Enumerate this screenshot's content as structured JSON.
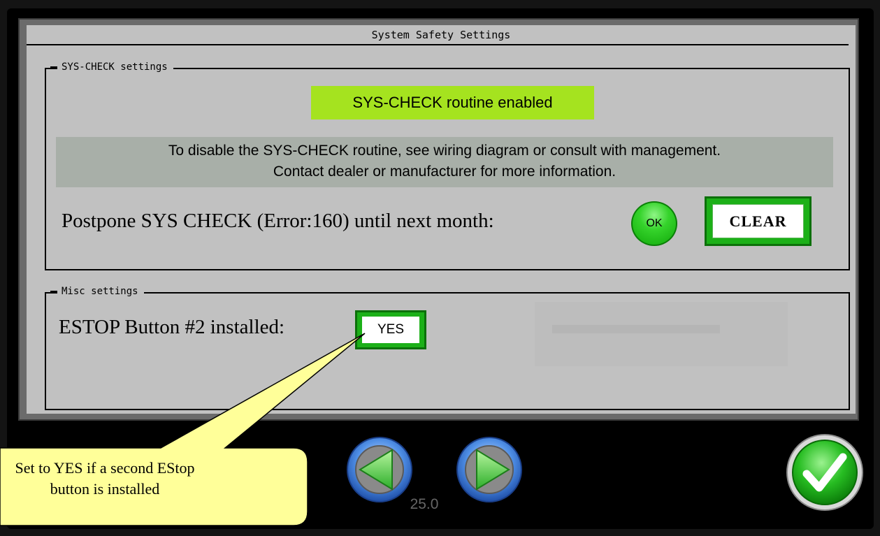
{
  "window": {
    "title": "System Safety Settings"
  },
  "syscheck_group": {
    "legend": "SYS-CHECK settings",
    "status": "SYS-CHECK routine enabled",
    "info_line1": "To disable the SYS-CHECK routine, see wiring diagram or consult with management.",
    "info_line2": "Contact dealer or manufacturer for more information.",
    "postpone_label": "Postpone SYS CHECK (Error:160) until next month:",
    "ok_label": "OK",
    "clear_label": "CLEAR"
  },
  "misc_group": {
    "legend": "Misc settings",
    "estop_label": "ESTOP Button #2 installed:",
    "estop_value": "YES"
  },
  "footer": {
    "version": "25.0",
    "prev_icon": "left-arrow-icon",
    "next_icon": "right-arrow-icon",
    "confirm_icon": "checkmark-icon"
  },
  "callout": {
    "line1": "Set to YES if a second EStop",
    "line2": "button is installed"
  },
  "colors": {
    "status_green": "#a5e31f",
    "button_green": "#1cb018",
    "screen_bg": "#c1c1c1",
    "callout_bg": "#ffff99"
  }
}
